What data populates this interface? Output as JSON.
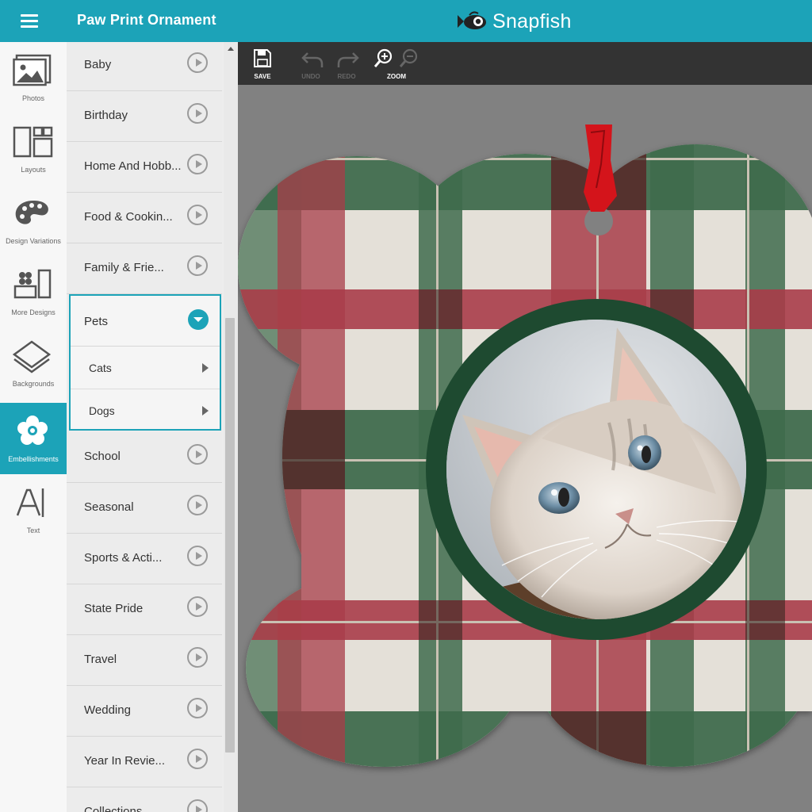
{
  "header": {
    "project_title": "Paw Print Ornament",
    "brand": "Snapfish"
  },
  "rail": {
    "items": [
      {
        "label": "Photos",
        "icon": "photos-icon"
      },
      {
        "label": "Layouts",
        "icon": "layouts-icon"
      },
      {
        "label": "Design Variations",
        "icon": "palette-icon"
      },
      {
        "label": "More Designs",
        "icon": "more-designs-icon"
      },
      {
        "label": "Backgrounds",
        "icon": "backgrounds-icon"
      },
      {
        "label": "Embellishments",
        "icon": "flower-icon",
        "active": true
      },
      {
        "label": "Text",
        "icon": "text-icon"
      }
    ]
  },
  "panel": {
    "categories_top": [
      "Baby",
      "Birthday",
      "Home And Hobb...",
      "Food & Cookin...",
      "Family & Frie..."
    ],
    "expanded": {
      "label": "Pets",
      "children": [
        "Cats",
        "Dogs"
      ]
    },
    "categories_bottom": [
      "School",
      "Seasonal",
      "Sports & Acti...",
      "State Pride",
      "Travel",
      "Wedding",
      "Year In Revie...",
      "Collections"
    ]
  },
  "toolbar": {
    "save": "SAVE",
    "undo": "UNDO",
    "redo": "REDO",
    "zoom": "ZOOM"
  },
  "colors": {
    "brand_teal": "#1ca3b8",
    "toolbar": "#333333",
    "canvas": "#818181",
    "plaid_green": "#3f6b4d",
    "plaid_red": "#a83d4a",
    "plaid_cream": "#e4e0d8",
    "frame_green": "#1e4a30",
    "ribbon_red": "#d4141b"
  }
}
